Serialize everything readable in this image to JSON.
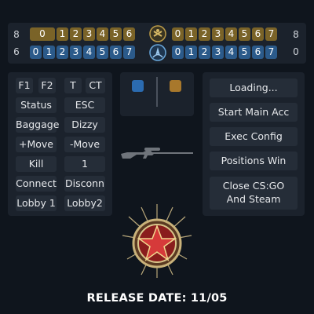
{
  "scoreboard": {
    "t_score": "8",
    "ct_score": "6",
    "t_score_right": "8",
    "ct_score_right": "0",
    "t_rounds_left": [
      "0",
      "1",
      "2",
      "3",
      "4",
      "5",
      "6"
    ],
    "ct_rounds_left": [
      "0",
      "1",
      "2",
      "3",
      "4",
      "5",
      "6",
      "7"
    ],
    "t_rounds_right": [
      "0",
      "1",
      "2",
      "3",
      "4",
      "5",
      "6",
      "7"
    ],
    "ct_rounds_right": [
      "0",
      "1",
      "2",
      "3",
      "4",
      "5",
      "6",
      "7"
    ],
    "t_badge_icon": "t-side-emblem-icon",
    "ct_badge_icon": "ct-side-emblem-icon",
    "t_color": "#7a6328",
    "ct_color": "#2b5a8a"
  },
  "binds": {
    "rows": [
      [
        "F1",
        "F2",
        "T",
        "CT"
      ],
      [
        "Status",
        "ESC"
      ],
      [
        "Baggage",
        "Dizzy"
      ],
      [
        "+Move",
        "-Move"
      ],
      [
        "Kill",
        "1"
      ],
      [
        "Connect",
        "Disconn"
      ],
      [
        "Lobby 1",
        "Lobby2"
      ]
    ]
  },
  "preview": {
    "weapon_icon": "sniper-rifle-icon",
    "ct_swatch_color": "#2b6bb0",
    "t_swatch_color": "#a8782c"
  },
  "actions": {
    "loading": "Loading...",
    "start_main": "Start Main Acc",
    "exec_config": "Exec Config",
    "positions_win": "Positions Win",
    "close_line1": "Close CS:GO",
    "close_line2": "And Steam"
  },
  "emblem_icon": "red-star-medal-icon",
  "release": "RELEASE DATE: 11/05"
}
